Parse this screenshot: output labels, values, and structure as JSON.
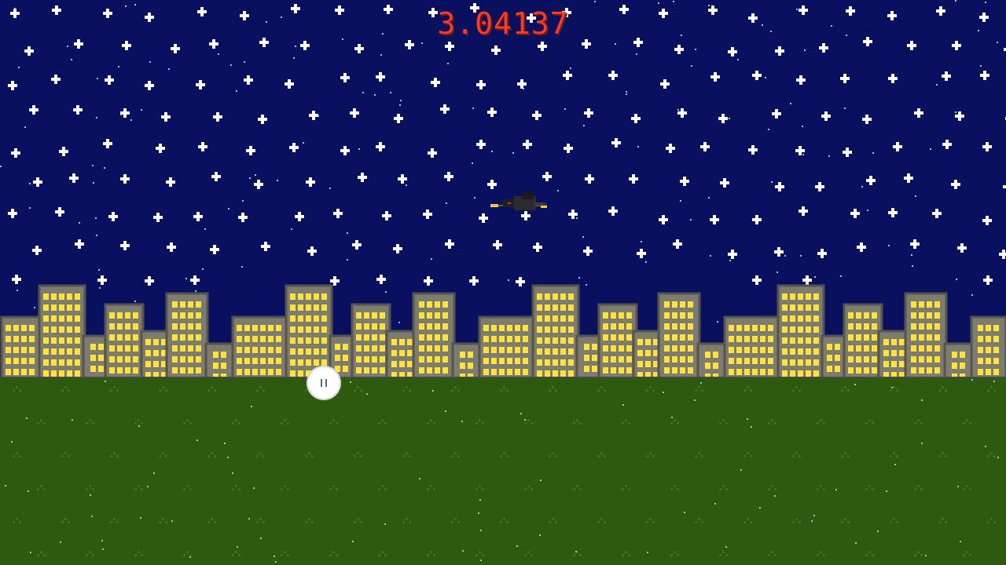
{
  "game": {
    "score": "3.04137"
  },
  "colors": {
    "sky": "#0a1060",
    "ground": "#2d5a0e",
    "ground_dots": "#3e6e22",
    "building": "#7c7c70",
    "building_outline": "#55554c",
    "window": "#ffe23a",
    "star": "#ffffff",
    "particle": "#7fffe0",
    "score": "#ff3b1f"
  },
  "icons": {
    "pause": "pause-icon",
    "player": "witch-on-broom-icon"
  }
}
